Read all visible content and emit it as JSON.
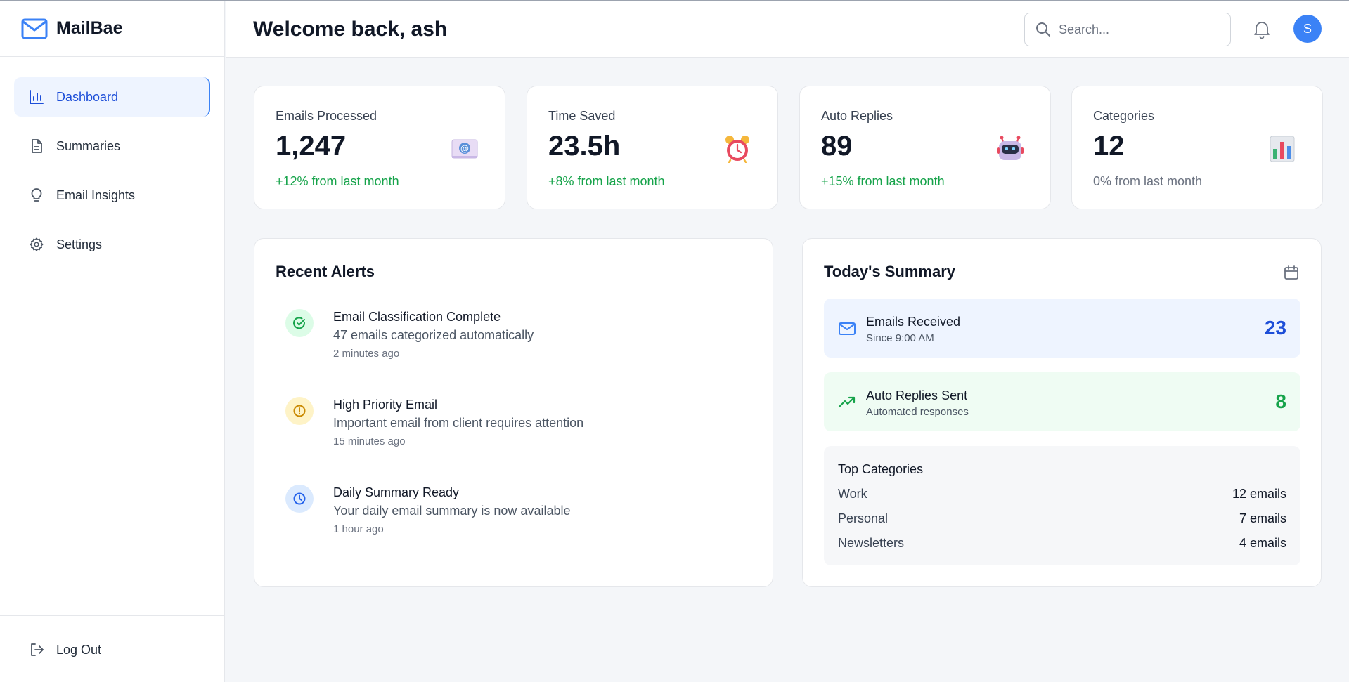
{
  "app": {
    "name": "MailBae"
  },
  "sidebar": {
    "items": [
      {
        "label": "Dashboard",
        "icon": "bar-chart-icon"
      },
      {
        "label": "Summaries",
        "icon": "document-icon"
      },
      {
        "label": "Email Insights",
        "icon": "lightbulb-icon"
      },
      {
        "label": "Settings",
        "icon": "gear-icon"
      }
    ],
    "logout": {
      "label": "Log Out",
      "icon": "logout-icon"
    }
  },
  "header": {
    "title": "Welcome back, ash",
    "search_placeholder": "Search...",
    "avatar_initial": "S"
  },
  "stats": [
    {
      "label": "Emails Processed",
      "value": "1,247",
      "delta": "+12% from last month",
      "icon": "email-at-icon"
    },
    {
      "label": "Time Saved",
      "value": "23.5h",
      "delta": "+8% from last month",
      "icon": "alarm-clock-icon"
    },
    {
      "label": "Auto Replies",
      "value": "89",
      "delta": "+15% from last month",
      "icon": "robot-icon"
    },
    {
      "label": "Categories",
      "value": "12",
      "delta": "0% from last month",
      "icon": "bar-chart-emoji-icon"
    }
  ],
  "alerts": {
    "title": "Recent Alerts",
    "items": [
      {
        "title": "Email Classification Complete",
        "desc": "47 emails categorized automatically",
        "time": "2 minutes ago",
        "icon": "check-circle-icon"
      },
      {
        "title": "High Priority Email",
        "desc": "Important email from client requires attention",
        "time": "15 minutes ago",
        "icon": "alert-circle-icon"
      },
      {
        "title": "Daily Summary Ready",
        "desc": "Your daily email summary is now available",
        "time": "1 hour ago",
        "icon": "clock-icon"
      }
    ]
  },
  "summary": {
    "title": "Today's Summary",
    "received": {
      "title": "Emails Received",
      "sub": "Since 9:00 AM",
      "count": "23"
    },
    "replies": {
      "title": "Auto Replies Sent",
      "sub": "Automated responses",
      "count": "8"
    },
    "categories": {
      "title": "Top Categories",
      "rows": [
        {
          "name": "Work",
          "count": "12 emails"
        },
        {
          "name": "Personal",
          "count": "7 emails"
        },
        {
          "name": "Newsletters",
          "count": "4 emails"
        }
      ]
    }
  },
  "colors": {
    "accent": "#3b82f6",
    "positive": "#16a34a",
    "received_bg": "#eef4ff",
    "replies_bg": "#effcf3"
  }
}
